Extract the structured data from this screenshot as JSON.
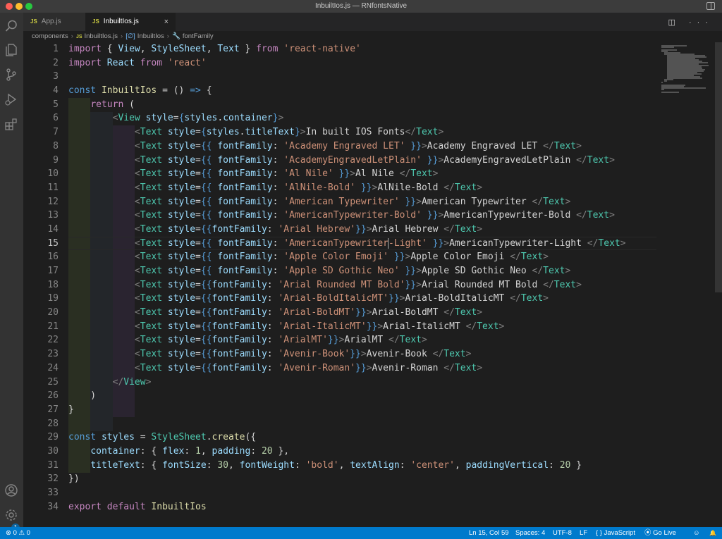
{
  "window": {
    "title": "InbuiltIos.js — RNfontsNative"
  },
  "tabs": [
    {
      "icon": "JS",
      "label": "App.js"
    },
    {
      "icon": "JS",
      "label": "InbuiltIos.js",
      "close": "×"
    }
  ],
  "tab_actions": "◫ ···",
  "breadcrumb": {
    "folder": "components",
    "file_icon": "JS",
    "file": "InbuiltIos.js",
    "symbol_icon": "[∅]",
    "symbol": "InbuiltIos",
    "property_icon": "🔧",
    "property": "fontFamily"
  },
  "editor": {
    "current_line": 15,
    "line_numbers": [
      "1",
      "2",
      "3",
      "4",
      "5",
      "6",
      "7",
      "8",
      "9",
      "10",
      "11",
      "12",
      "13",
      "14",
      "15",
      "16",
      "17",
      "18",
      "19",
      "20",
      "21",
      "22",
      "23",
      "24",
      "25",
      "26",
      "27",
      "28",
      "29",
      "30",
      "31",
      "32",
      "33",
      "34"
    ]
  },
  "code": {
    "l1": [
      "import",
      " { ",
      "View",
      ", ",
      "StyleSheet",
      ", ",
      "Text",
      " } ",
      "from",
      " ",
      "'react-native'"
    ],
    "l2": [
      "import",
      " ",
      "React",
      " ",
      "from",
      " ",
      "'react'"
    ],
    "l4": [
      "const",
      " ",
      "InbuiltIos",
      " = () ",
      "=>",
      " {"
    ],
    "l5": [
      "    ",
      "return",
      " ("
    ],
    "l6": [
      "        ",
      "<",
      "View",
      " ",
      "style",
      "=",
      "{",
      "styles",
      ".",
      "container",
      "}",
      ">"
    ],
    "l7": [
      "            ",
      "<",
      "Text",
      " ",
      "style",
      "=",
      "{",
      "styles",
      ".",
      "titleText",
      "}",
      ">",
      "In built IOS Fonts",
      "</",
      "Text",
      ">"
    ],
    "fonts": [
      {
        "pre": "{{ ",
        "key": "fontFamily",
        "val": "'Academy Engraved LET'",
        "post": " }}",
        "label": "Academy Engraved LET "
      },
      {
        "pre": "{{ ",
        "key": "fontFamily",
        "val": "'AcademyEngravedLetPlain'",
        "post": " }}",
        "label": "AcademyEngravedLetPlain "
      },
      {
        "pre": "{{ ",
        "key": "fontFamily",
        "val": "'Al Nile'",
        "post": " }}",
        "label": "Al Nile "
      },
      {
        "pre": "{{ ",
        "key": "fontFamily",
        "val": "'AlNile-Bold'",
        "post": " }}",
        "label": "AlNile-Bold "
      },
      {
        "pre": "{{ ",
        "key": "fontFamily",
        "val": "'American Typewriter'",
        "post": " }}",
        "label": "American Typewriter "
      },
      {
        "pre": "{{ ",
        "key": "fontFamily",
        "val": "'AmericanTypewriter-Bold'",
        "post": " }}",
        "label": "AmericanTypewriter-Bold "
      },
      {
        "pre": "{{",
        "key": "fontFamily",
        "val": "'Arial Hebrew'",
        "post": "}}",
        "label": "Arial Hebrew "
      },
      {
        "pre": "{{ ",
        "key": "fontFamily",
        "val": "'AmericanTypewriter-Light'",
        "post": " }}",
        "label": "AmericanTypewriter-Light "
      },
      {
        "pre": "{{ ",
        "key": "fontFamily",
        "val": "'Apple Color Emoji'",
        "post": " }}",
        "label": "Apple Color Emoji "
      },
      {
        "pre": "{{ ",
        "key": "fontFamily",
        "val": "'Apple SD Gothic Neo'",
        "post": " }}",
        "label": "Apple SD Gothic Neo "
      },
      {
        "pre": "{{",
        "key": "fontFamily",
        "val": "'Arial Rounded MT Bold'",
        "post": "}}",
        "label": "Arial Rounded MT Bold "
      },
      {
        "pre": "{{",
        "key": "fontFamily",
        "val": "'Arial-BoldItalicMT'",
        "post": "}}",
        "label": "Arial-BoldItalicMT "
      },
      {
        "pre": "{{",
        "key": "fontFamily",
        "val": "'Arial-BoldMT'",
        "post": "}}",
        "label": "Arial-BoldMT "
      },
      {
        "pre": "{{",
        "key": "fontFamily",
        "val": "'Arial-ItalicMT'",
        "post": "}}",
        "label": "Arial-ItalicMT "
      },
      {
        "pre": "{{",
        "key": "fontFamily",
        "val": "'ArialMT'",
        "post": "}}",
        "label": "ArialMT "
      },
      {
        "pre": "{{",
        "key": "fontFamily",
        "val": "'Avenir-Book'",
        "post": "}}",
        "label": "Avenir-Book "
      },
      {
        "pre": "{{",
        "key": "fontFamily",
        "val": "'Avenir-Roman'",
        "post": "}}",
        "label": "Avenir-Roman "
      }
    ],
    "l25": [
      "        ",
      "</",
      "View",
      ">"
    ],
    "l26": [
      "    )"
    ],
    "l27": [
      "}"
    ],
    "l29": [
      "const",
      " ",
      "styles",
      " = ",
      "StyleSheet",
      ".",
      "create",
      "({"
    ],
    "l30": [
      "    ",
      "container",
      ": { ",
      "flex",
      ": ",
      "1",
      ", ",
      "padding",
      ": ",
      "20",
      " },"
    ],
    "l31": [
      "    ",
      "titleText",
      ": { ",
      "fontSize",
      ": ",
      "30",
      ", ",
      "fontWeight",
      ": ",
      "'bold'",
      ", ",
      "textAlign",
      ": ",
      "'center'",
      ", ",
      "paddingVertical",
      ": ",
      "20",
      " }"
    ],
    "l32": [
      "})"
    ],
    "l34": [
      "export",
      " ",
      "default",
      " ",
      "InbuiltIos"
    ]
  },
  "statusbar": {
    "errors": "⊗ 0 ⚠ 0",
    "position": "Ln 15, Col 59",
    "spaces": "Spaces: 4",
    "encoding": "UTF-8",
    "eol": "LF",
    "language": "{ }  JavaScript",
    "golive": "⦿ Go Live",
    "feedback": "☺",
    "bell": "🔔"
  },
  "activity_badge": "1",
  "colors": {
    "accent": "#007acc",
    "editor_bg": "#1e1e1e",
    "activity_bg": "#333333"
  }
}
